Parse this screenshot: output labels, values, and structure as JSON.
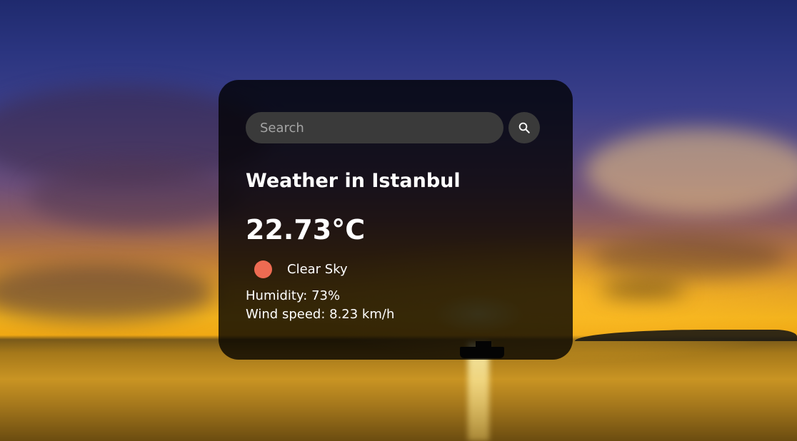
{
  "search": {
    "placeholder": "Search",
    "value": ""
  },
  "weather": {
    "title": "Weather in Istanbul",
    "temperature": "22.73°C",
    "condition": "Clear Sky",
    "condition_icon": "sun-icon",
    "humidity": "Humidity: 73%",
    "wind": "Wind speed: 8.23 km/h"
  },
  "colors": {
    "card_background": "#000000c7",
    "input_background": "#3a3a3a",
    "icon_accent": "#ee6b52",
    "text": "#ffffff"
  }
}
